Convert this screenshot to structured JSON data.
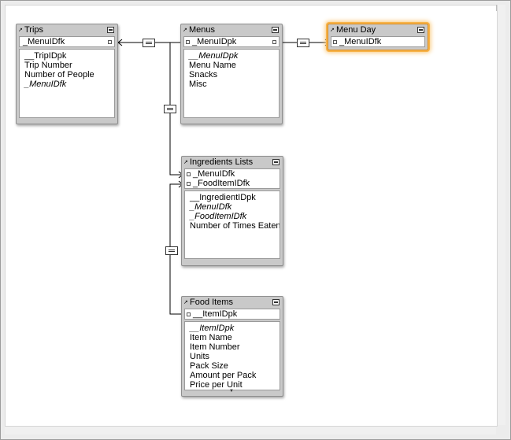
{
  "tables": [
    {
      "id": "trips",
      "title": "Trips",
      "keys": [
        "_MenuIDfk"
      ],
      "fields": [
        {
          "text": "__TripIDpk",
          "italic": false
        },
        {
          "text": "Trip Number",
          "italic": false
        },
        {
          "text": "Number of People",
          "italic": false
        },
        {
          "text": "_MenuIDfk",
          "italic": true
        }
      ]
    },
    {
      "id": "menus",
      "title": "Menus",
      "keys": [
        "_MenuIDpk"
      ],
      "fields": [
        {
          "text": "__MenuIDpk",
          "italic": true
        },
        {
          "text": "Menu Name",
          "italic": false
        },
        {
          "text": "Snacks",
          "italic": false
        },
        {
          "text": "Misc",
          "italic": false
        }
      ]
    },
    {
      "id": "menu-day",
      "title": "Menu Day",
      "keys": [
        "_MenuIDfk"
      ],
      "fields": []
    },
    {
      "id": "ingredients-lists",
      "title": "Ingredients Lists",
      "keys": [
        "_MenuIDfk",
        "_FoodItemIDfk"
      ],
      "fields": [
        {
          "text": "__IngredientIDpk",
          "italic": false
        },
        {
          "text": "_MenuIDfk",
          "italic": true
        },
        {
          "text": "_FoodItemIDfk",
          "italic": true
        },
        {
          "text": "Number of Times Eaten",
          "italic": false
        }
      ]
    },
    {
      "id": "food-items",
      "title": "Food Items",
      "keys": [
        "__ItemIDpk"
      ],
      "fields": [
        {
          "text": "__ItemIDpk",
          "italic": true
        },
        {
          "text": "Item Name",
          "italic": false
        },
        {
          "text": "Item Number",
          "italic": false
        },
        {
          "text": "Units",
          "italic": false
        },
        {
          "text": "Pack Size",
          "italic": false
        },
        {
          "text": "Amount per Pack",
          "italic": false
        },
        {
          "text": "Price per Unit",
          "italic": false
        }
      ]
    }
  ],
  "colors": {
    "selection": "#f7b34a",
    "table_header": "#c9c9c9",
    "canvas": "#ffffff"
  },
  "icons": {
    "table_header": "arrow-icon",
    "collapse": "collapse-icon",
    "relationship": "equals-operator-icon",
    "key_port": "port-icon",
    "overflow": "more-fields-icon"
  }
}
